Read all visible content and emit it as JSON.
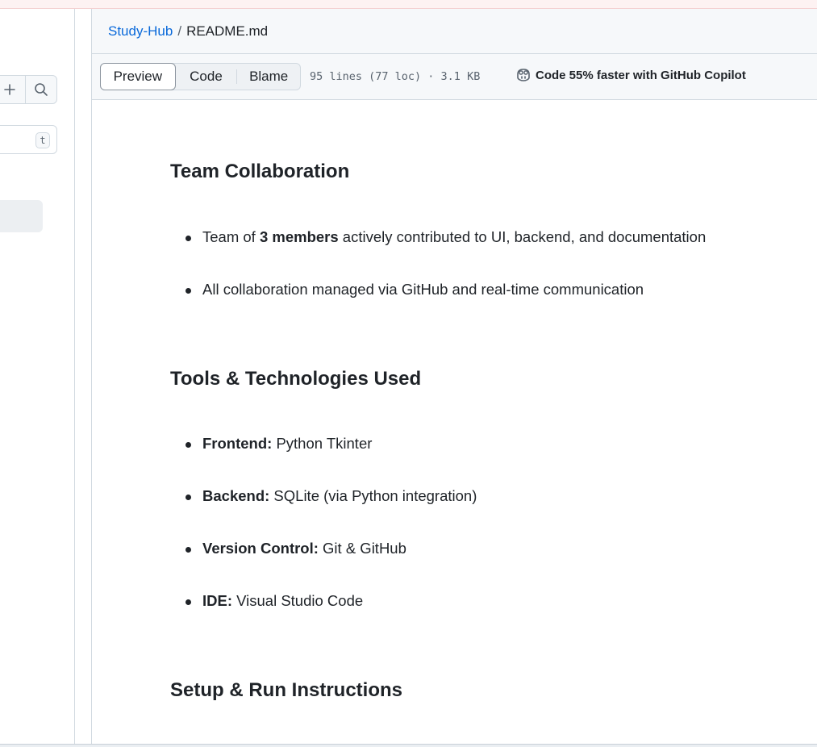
{
  "sidebar": {
    "filter_shortcut": "t"
  },
  "breadcrumb": {
    "repo": "Study-Hub",
    "separator": "/",
    "file": "README.md"
  },
  "toolbar": {
    "tabs": [
      "Preview",
      "Code",
      "Blame"
    ],
    "file_info": "95 lines (77 loc) · 3.1 KB",
    "copilot_text": "Code 55% faster with GitHub Copilot"
  },
  "readme": {
    "team_heading": "Team Collaboration",
    "team_item1_pre": "Team of ",
    "team_item1_bold": "3 members",
    "team_item1_post": " actively contributed to UI, backend, and documentation",
    "team_item2": "All collaboration managed via GitHub and real-time communication",
    "tools_heading": "Tools & Technologies Used",
    "tools": [
      {
        "label": "Frontend:",
        "value": " Python Tkinter"
      },
      {
        "label": "Backend:",
        "value": " SQLite (via Python integration)"
      },
      {
        "label": "Version Control:",
        "value": " Git & GitHub"
      },
      {
        "label": "IDE:",
        "value": " Visual Studio Code"
      }
    ],
    "setup_heading": "Setup & Run Instructions"
  },
  "colors": {
    "link": "#0969da",
    "border": "#d1d9e0",
    "header_bg": "#f6f8fa"
  }
}
